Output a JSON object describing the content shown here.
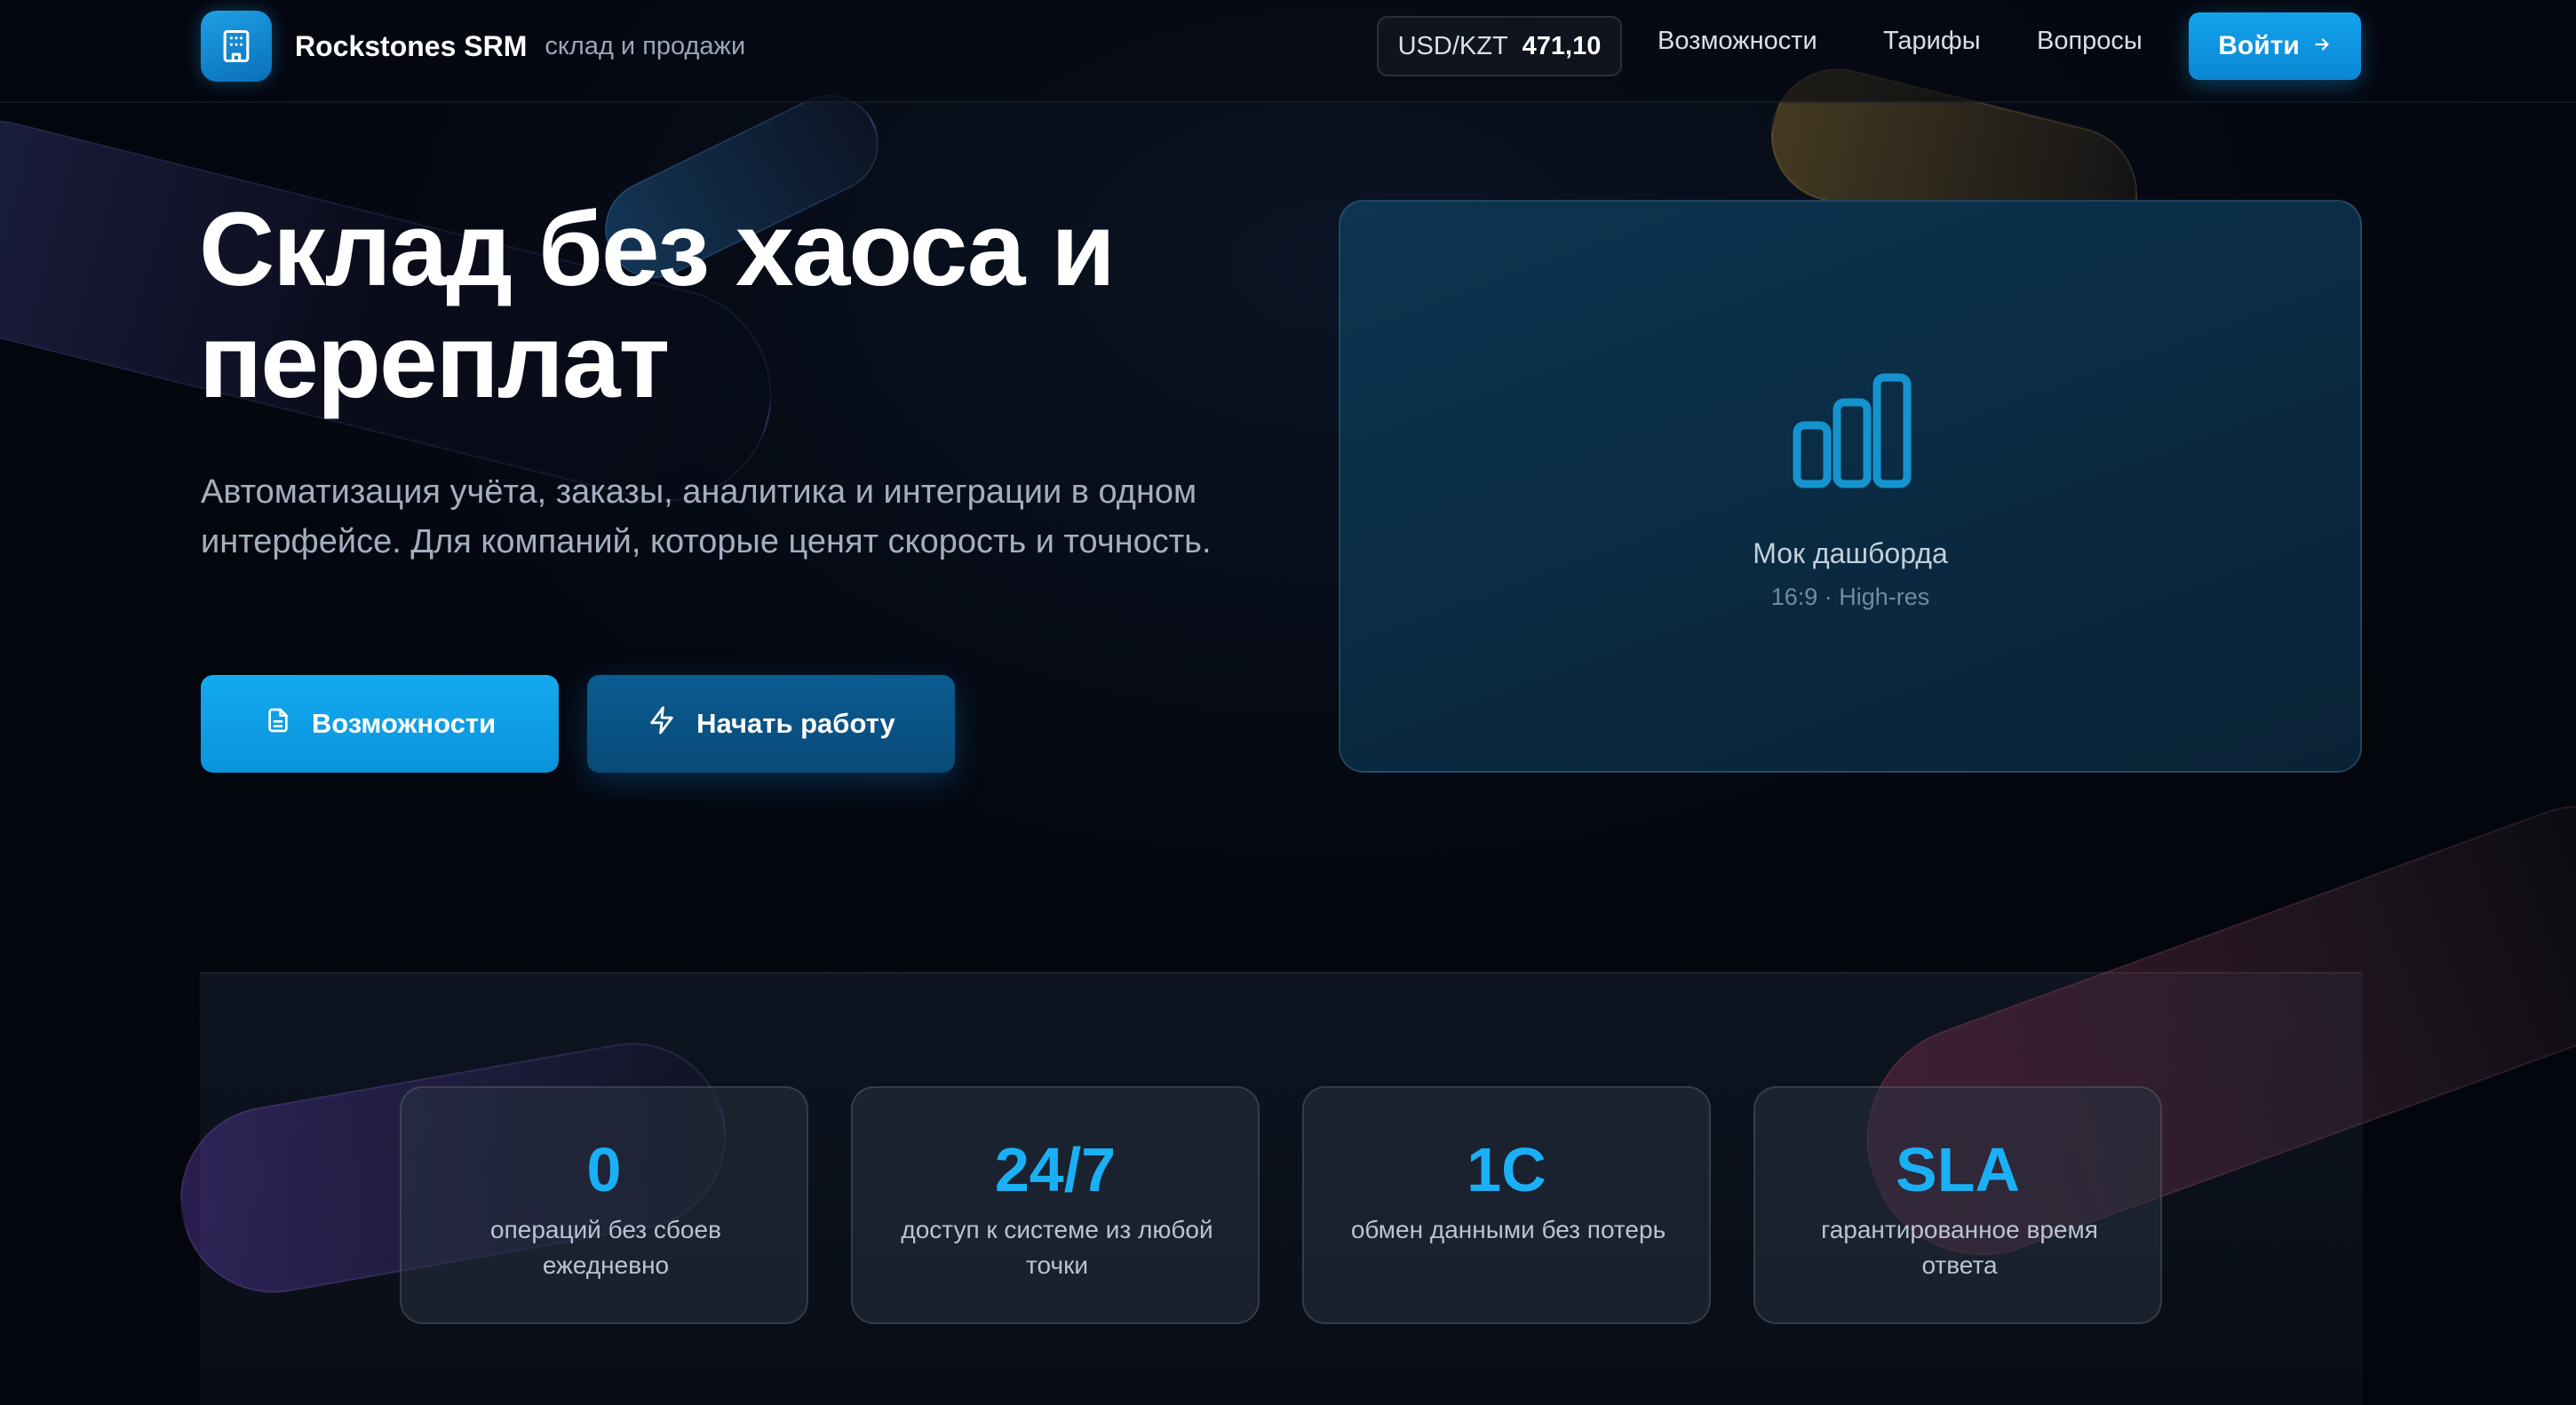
{
  "header": {
    "brand_name": "Rockstones SRM",
    "brand_sub": "склад и продажи",
    "rate_pair": "USD/KZT",
    "rate_value": "471,10",
    "nav": [
      "Возможности",
      "Тарифы",
      "Вопросы"
    ],
    "login_label": "Войти"
  },
  "hero": {
    "title": "Склад без хаоса и переплат",
    "description": "Автоматизация учёта, заказы, аналитика и интеграции в одном интерфейсе. Для компаний, которые ценят скорость и точность.",
    "primary_button": "Возможности",
    "secondary_button": "Начать работу"
  },
  "mock": {
    "title": "Мок дашборда",
    "subtitle": "16:9 · High-res"
  },
  "stats": [
    {
      "value": "0",
      "label": "операций без сбоев ежедневно"
    },
    {
      "value": "24/7",
      "label": "доступ к системе из любой точки"
    },
    {
      "value": "1С",
      "label": "обмен данными без потерь"
    },
    {
      "value": "SLA",
      "label": "гарантированное время ответа"
    }
  ],
  "colors": {
    "accent": "#13a3ee",
    "stat_value": "#1ab0f5",
    "background": "#050812"
  },
  "icons": {
    "brand": "building-icon",
    "login": "arrow-right-icon",
    "primary_button": "document-icon",
    "secondary_button": "lightning-icon",
    "mock": "bar-chart-icon"
  }
}
